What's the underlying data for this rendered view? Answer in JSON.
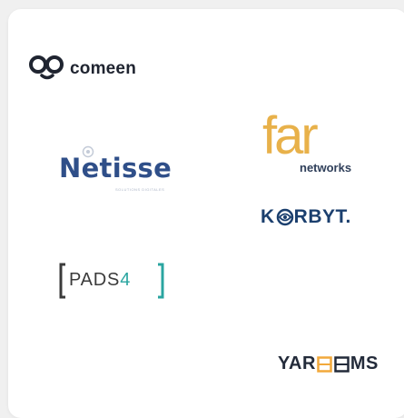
{
  "logos": {
    "comeen": {
      "word": "comeen"
    },
    "far": {
      "word": "far",
      "sub": "networks"
    },
    "netisse": {
      "word": "Netisse",
      "tagline": "SOLUTIONS DIGITALES"
    },
    "korbyt": {
      "pre": "K",
      "post": "RBYT."
    },
    "pads4": {
      "pre": "PADS",
      "num": "4"
    },
    "yarooms": {
      "pre": "YAR",
      "post": "MS"
    }
  },
  "colors": {
    "far_orange": "#e8b14a",
    "netisse_blue": "#2f4f89",
    "korbyt_navy": "#1b3f6e",
    "pads_teal": "#2aa5a0",
    "yarooms_accent": "#f2a93b"
  }
}
